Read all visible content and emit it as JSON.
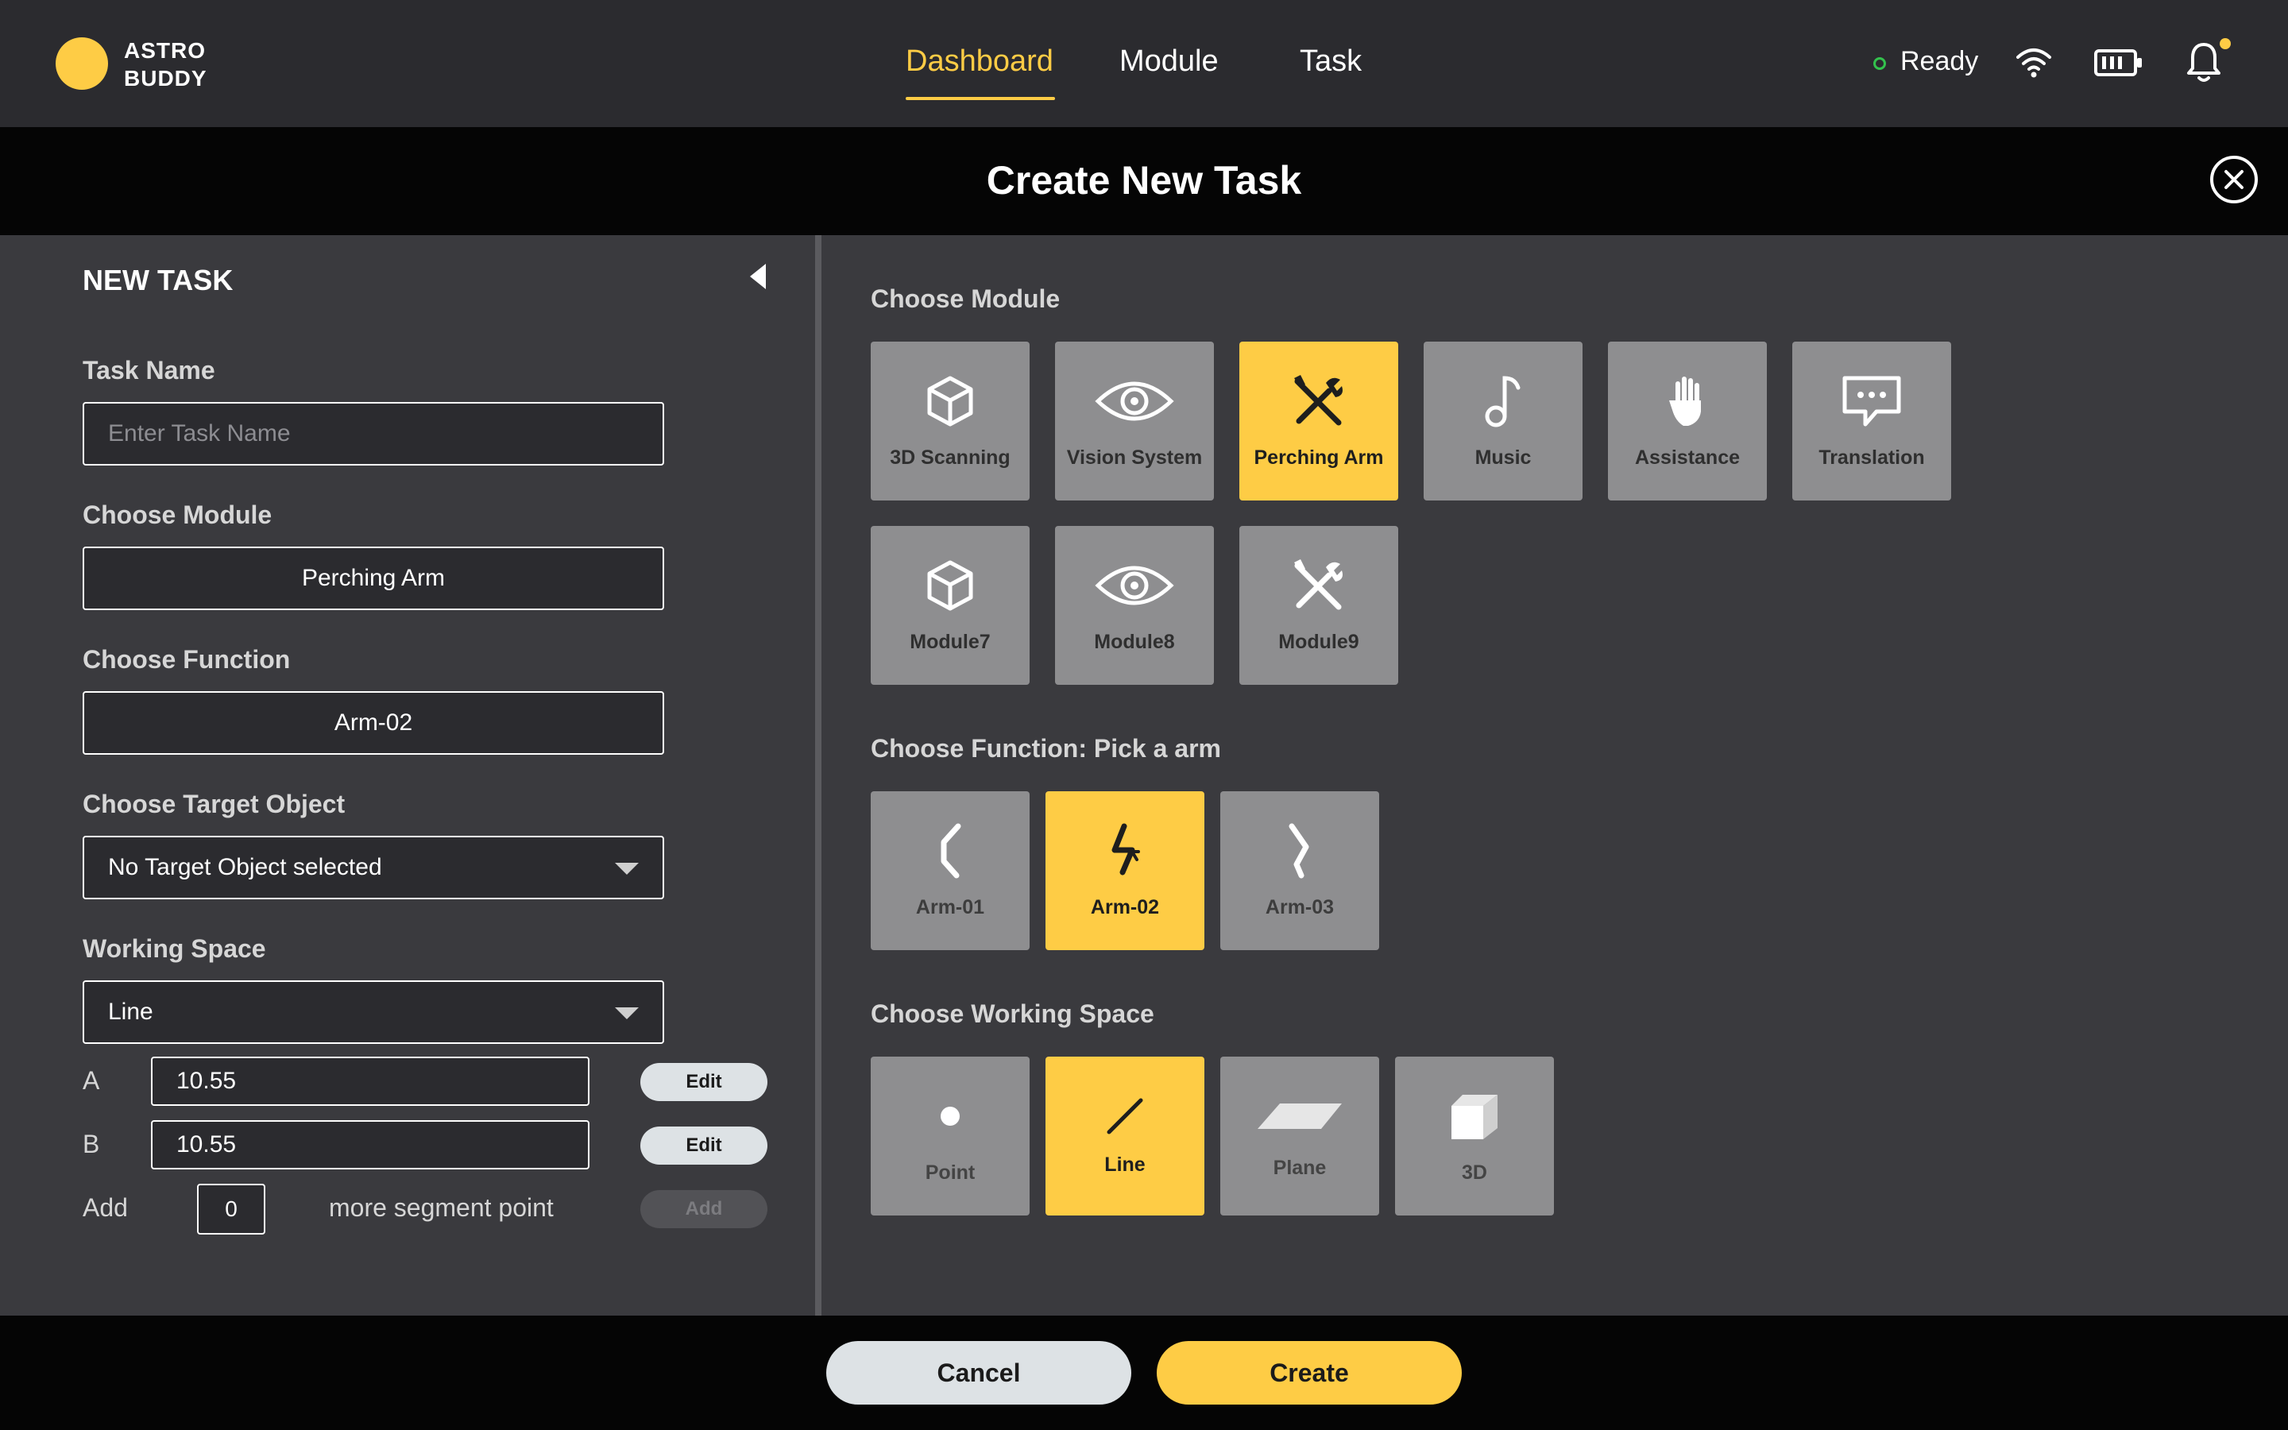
{
  "brand": {
    "line1": "ASTRO",
    "line2": "BUDDY"
  },
  "nav": {
    "tabs": [
      "Dashboard",
      "Module",
      "Task"
    ],
    "active": "Dashboard"
  },
  "status": {
    "text": "Ready"
  },
  "modal": {
    "title": "Create New Task"
  },
  "left": {
    "title": "NEW TASK",
    "task_name": {
      "label": "Task Name",
      "placeholder": "Enter Task Name",
      "value": ""
    },
    "module": {
      "label": "Choose Module",
      "value": "Perching Arm"
    },
    "function": {
      "label": "Choose Function",
      "value": "Arm-02"
    },
    "target": {
      "label": "Choose Target Object",
      "value": "No Target Object selected"
    },
    "workspace": {
      "label": "Working Space",
      "value": "Line"
    },
    "points": [
      {
        "label": "A",
        "value": "10.55",
        "button": "Edit"
      },
      {
        "label": "B",
        "value": "10.55",
        "button": "Edit"
      }
    ],
    "add_row": {
      "prefix": "Add",
      "count": "0",
      "suffix": "more segment point",
      "button": "Add"
    }
  },
  "right": {
    "module_title": "Choose Module",
    "modules": [
      {
        "label": "3D Scanning",
        "icon": "cube-icon",
        "selected": false
      },
      {
        "label": "Vision System",
        "icon": "eye-icon",
        "selected": false
      },
      {
        "label": "Perching Arm",
        "icon": "tools-icon",
        "selected": true
      },
      {
        "label": "Music",
        "icon": "music-note-icon",
        "selected": false
      },
      {
        "label": "Assistance",
        "icon": "hand-icon",
        "selected": false
      },
      {
        "label": "Translation",
        "icon": "chat-bubble-icon",
        "selected": false
      },
      {
        "label": "Module7",
        "icon": "cube-icon",
        "selected": false
      },
      {
        "label": "Module8",
        "icon": "eye-icon",
        "selected": false
      },
      {
        "label": "Module9",
        "icon": "tools-icon",
        "selected": false
      }
    ],
    "function_title": "Choose Function: Pick a arm",
    "functions": [
      {
        "label": "Arm-01",
        "icon": "arm-left-icon",
        "selected": false
      },
      {
        "label": "Arm-02",
        "icon": "arm-bent-icon",
        "selected": true
      },
      {
        "label": "Arm-03",
        "icon": "arm-right-icon",
        "selected": false
      }
    ],
    "workspace_title": "Choose Working Space",
    "workspaces": [
      {
        "label": "Point",
        "icon": "point-icon",
        "selected": false
      },
      {
        "label": "Line",
        "icon": "line-icon",
        "selected": true
      },
      {
        "label": "Plane",
        "icon": "plane-icon",
        "selected": false
      },
      {
        "label": "3D",
        "icon": "box-3d-icon",
        "selected": false
      }
    ]
  },
  "footer": {
    "cancel": "Cancel",
    "create": "Create"
  },
  "colors": {
    "accent": "#fecc45",
    "background": "#2b2b2f",
    "panel": "#3a3a3e",
    "tile": "#8e8e90",
    "status_ok": "#33c24d"
  }
}
